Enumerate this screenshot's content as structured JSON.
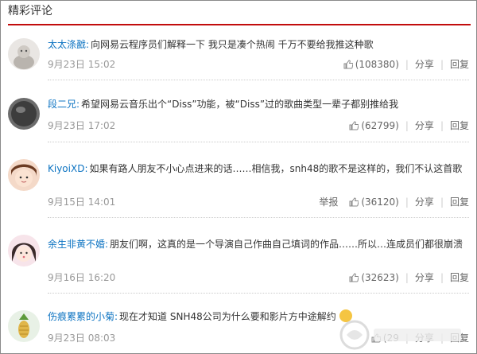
{
  "section": {
    "title": "精彩评论"
  },
  "labels": {
    "share": "分享",
    "reply": "回复",
    "report": "举报"
  },
  "comments": [
    {
      "user": "太太涤戤:",
      "text": "向网易云程序员们解释一下 我只是凑个热闹 千万不要给我推这种歌",
      "time": "9月23日 15:02",
      "likes": "(108380)"
    },
    {
      "user": "段二兄:",
      "text": "希望网易云音乐出个“Diss”功能，被“Diss”过的歌曲类型一辈子都别推给我",
      "time": "9月23日 17:02",
      "likes": "(62799)"
    },
    {
      "user": "KiyoiXD:",
      "text": "如果有路人朋友不小心点进来的话……相信我，snh48的歌不是这样的，我们不认这首歌",
      "time": "9月15日 14:01",
      "likes": "(36120)"
    },
    {
      "user": "余生非黄不婚:",
      "text": "朋友们啊，这真的是一个导演自己作曲自己填词的作品……所以…连成员们都很崩溃",
      "time": "9月16日 16:20",
      "likes": "(32623)"
    },
    {
      "user": "伤痕累累的小菊:",
      "text": "现在才知道 SNH48公司为什么要和影片方中途解约",
      "time": "9月23日 08:03",
      "likes": "(29"
    }
  ],
  "icons": {
    "thumb": "thumbs-up-icon",
    "emoji": "laughing-emoji-icon"
  },
  "colors": {
    "accent_red": "#c20c0c",
    "link_blue": "#0c73c2",
    "meta_gray": "#999999"
  }
}
